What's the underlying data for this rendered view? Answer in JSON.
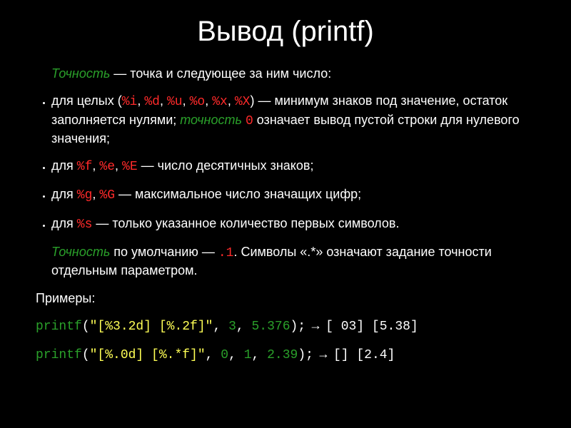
{
  "title": "Вывод (printf)",
  "lead": {
    "term": "Точность",
    "text": " — точка и следующее за ним число:"
  },
  "bullets": [
    {
      "pre": "для целых (",
      "fmts": [
        "%i",
        "%d",
        "%u",
        "%o",
        "%x",
        "%X"
      ],
      "post": ") — минимум знаков под значение, остаток заполняется нулями; ",
      "term": "точность",
      "zero": "0",
      "tail": " означает вывод пустой строки для нулевого значения;"
    },
    {
      "pre": "для ",
      "fmts": [
        "%f",
        "%e",
        "%E"
      ],
      "tail": " — число десятичных знаков;"
    },
    {
      "pre": "для ",
      "fmts": [
        "%g",
        "%G"
      ],
      "tail": " — максимальное число значащих цифр;"
    },
    {
      "pre": "для ",
      "fmts": [
        "%s"
      ],
      "tail": " — только указанное количество первых символов."
    }
  ],
  "default": {
    "term": "Точность",
    "mid": " по умолчанию — ",
    "val": ".1",
    "tail": ". Символы «.*» означают задание точности отдельным параметром."
  },
  "examples_label": "Примеры:",
  "examples": [
    {
      "call": "printf",
      "open": "(",
      "str": "\"[%3.2d] [%.2f]\"",
      "args": [
        ", ",
        "3",
        ", ",
        "5.376"
      ],
      "close": ");",
      "arrow": " → ",
      "out": "[ 03] [5.38]"
    },
    {
      "call": "printf",
      "open": "(",
      "str": "\"[%.0d] [%.*f]\"",
      "args": [
        ", ",
        "0",
        ", ",
        "1",
        ", ",
        "2.39"
      ],
      "close": ");",
      "arrow": " → ",
      "out": "[] [2.4]"
    }
  ]
}
